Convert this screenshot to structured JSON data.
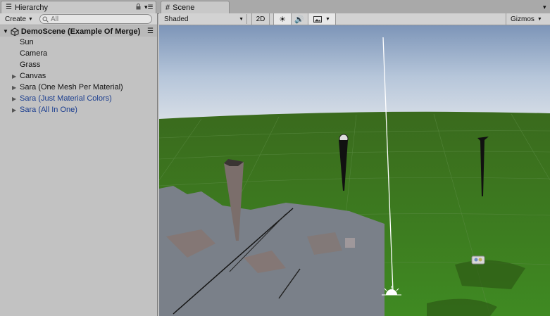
{
  "tabs": {
    "hierarchy": "Hierarchy",
    "scene": "Scene"
  },
  "hierarchy": {
    "create_label": "Create",
    "search_placeholder": "All",
    "scene_name": "DemoScene (Example Of Merge)",
    "items": [
      {
        "label": "Sun",
        "expandable": false,
        "color": "default"
      },
      {
        "label": "Camera",
        "expandable": false,
        "color": "default"
      },
      {
        "label": "Grass",
        "expandable": false,
        "color": "default"
      },
      {
        "label": "Canvas",
        "expandable": true,
        "color": "default"
      },
      {
        "label": "Sara (One Mesh Per Material)",
        "expandable": true,
        "color": "default"
      },
      {
        "label": "Sara (Just Material Colors)",
        "expandable": true,
        "color": "#1a3d8f"
      },
      {
        "label": "Sara (All In One)",
        "expandable": true,
        "color": "#1a3d8f"
      }
    ]
  },
  "scene_toolbar": {
    "shading_mode": "Shaded",
    "mode_2d": "2D",
    "gizmos": "Gizmos"
  },
  "icons": [
    "list-icon",
    "lock-icon",
    "menu-icon",
    "scene-grid-icon",
    "unity-scene-icon",
    "sun-icon",
    "audio-icon",
    "image-effects-icon",
    "dropdown-arrow-icon"
  ]
}
